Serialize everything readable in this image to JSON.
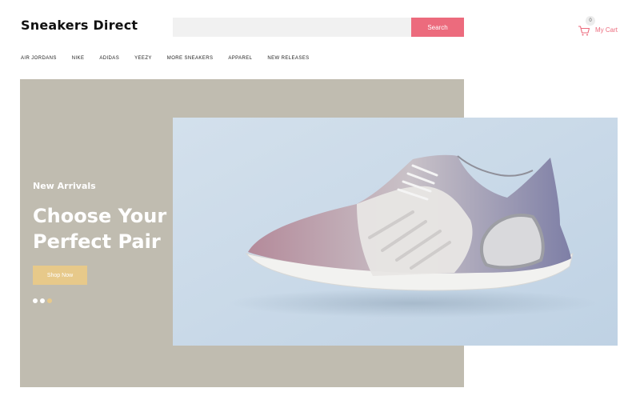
{
  "header": {
    "logo": "Sneakers Direct",
    "search": {
      "placeholder": "",
      "button_label": "Search"
    },
    "cart": {
      "count": "0",
      "label": "My Cart"
    }
  },
  "nav": {
    "items": [
      {
        "label": "AIR JORDANS"
      },
      {
        "label": "NIKE"
      },
      {
        "label": "ADIDAS"
      },
      {
        "label": "YEEZY"
      },
      {
        "label": "MORE SNEAKERS"
      },
      {
        "label": "APPAREL"
      },
      {
        "label": "NEW RELEASES"
      }
    ]
  },
  "hero": {
    "subtitle": "New Arrivals",
    "title_line1": "Choose Your",
    "title_line2": "Perfect Pair",
    "cta_label": "Shop Now",
    "slides": 3,
    "active_slide": 3
  },
  "colors": {
    "accent": "#ec6b7d",
    "cta": "#e7c98a",
    "hero_bg": "#c0bcb0",
    "image_bg": "#c9d9e8",
    "active_dot": "#e7c98a"
  },
  "icons": {
    "cart": "cart-icon"
  }
}
